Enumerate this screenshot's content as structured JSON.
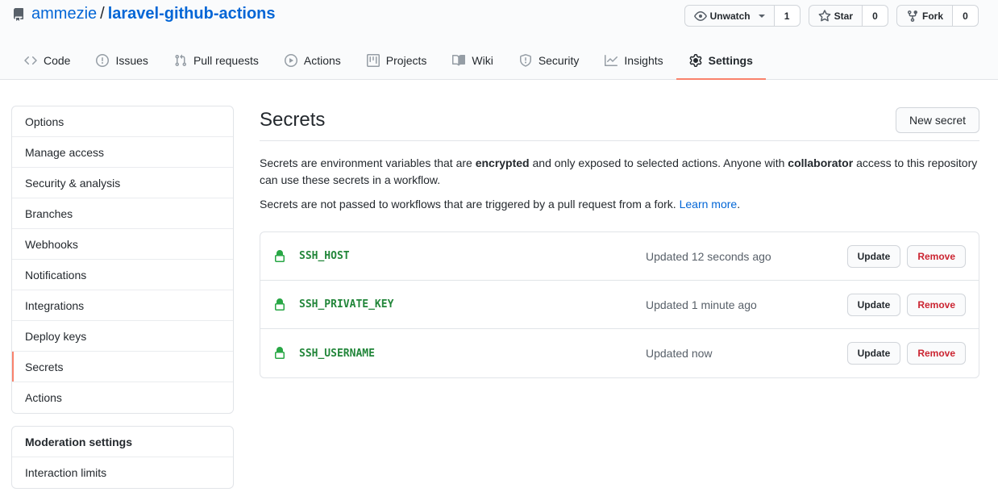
{
  "repo": {
    "owner": "ammezie",
    "separator": "/",
    "name": "laravel-github-actions"
  },
  "actions": {
    "watch": {
      "label": "Unwatch",
      "count": "1",
      "icon": "eye-icon"
    },
    "star": {
      "label": "Star",
      "count": "0",
      "icon": "star-icon"
    },
    "fork": {
      "label": "Fork",
      "count": "0",
      "icon": "fork-icon"
    }
  },
  "tabs": [
    {
      "label": "Code",
      "icon": "code-icon"
    },
    {
      "label": "Issues",
      "icon": "issue-icon"
    },
    {
      "label": "Pull requests",
      "icon": "pull-request-icon"
    },
    {
      "label": "Actions",
      "icon": "play-icon"
    },
    {
      "label": "Projects",
      "icon": "project-icon"
    },
    {
      "label": "Wiki",
      "icon": "book-icon"
    },
    {
      "label": "Security",
      "icon": "shield-icon"
    },
    {
      "label": "Insights",
      "icon": "graph-icon"
    },
    {
      "label": "Settings",
      "icon": "gear-icon",
      "selected": true
    }
  ],
  "sidebar": {
    "items": [
      {
        "label": "Options"
      },
      {
        "label": "Manage access"
      },
      {
        "label": "Security & analysis"
      },
      {
        "label": "Branches"
      },
      {
        "label": "Webhooks"
      },
      {
        "label": "Notifications"
      },
      {
        "label": "Integrations"
      },
      {
        "label": "Deploy keys"
      },
      {
        "label": "Secrets",
        "selected": true
      },
      {
        "label": "Actions"
      }
    ],
    "moderation": {
      "heading": "Moderation settings",
      "items": [
        {
          "label": "Interaction limits"
        }
      ]
    }
  },
  "main": {
    "title": "Secrets",
    "new_secret_label": "New secret",
    "description": {
      "part1": "Secrets are environment variables that are ",
      "bold1": "encrypted",
      "part2": " and only exposed to selected actions. Anyone with ",
      "bold2": "collaborator",
      "part3": " access to this repository can use these secrets in a workflow."
    },
    "fork_note": {
      "text": "Secrets are not passed to workflows that are triggered by a pull request from a fork. ",
      "link": "Learn more",
      "end": "."
    },
    "secrets": [
      {
        "name": "SSH_HOST",
        "updated": "Updated 12 seconds ago",
        "update_label": "Update",
        "remove_label": "Remove"
      },
      {
        "name": "SSH_PRIVATE_KEY",
        "updated": "Updated 1 minute ago",
        "update_label": "Update",
        "remove_label": "Remove"
      },
      {
        "name": "SSH_USERNAME",
        "updated": "Updated now",
        "update_label": "Update",
        "remove_label": "Remove"
      }
    ]
  },
  "colors": {
    "link": "#0366d6",
    "accent_underline": "#f9826c",
    "secret_name": "#22863a",
    "danger": "#cb2431"
  }
}
